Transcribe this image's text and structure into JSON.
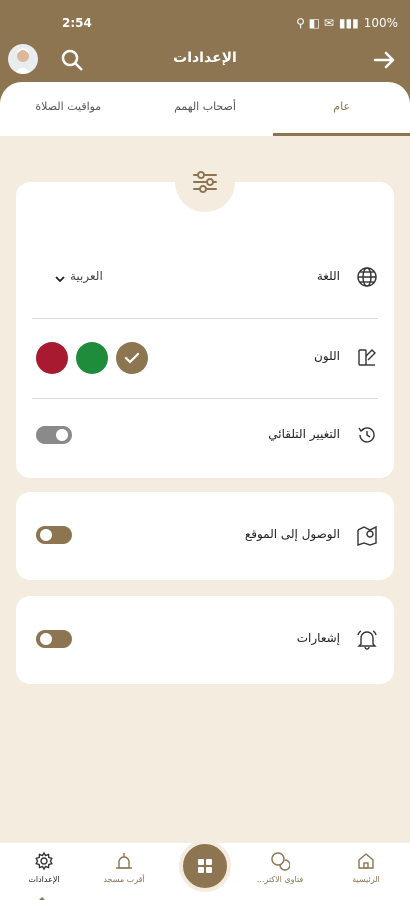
{
  "status": {
    "time": "2:54",
    "battery": "100%"
  },
  "header": {
    "title": "الإعدادات"
  },
  "tabs": [
    {
      "label": "عام",
      "active": true
    },
    {
      "label": "أصحاب الهمم",
      "active": false
    },
    {
      "label": "مواقيت الصلاة",
      "active": false
    }
  ],
  "settings": {
    "language": {
      "label": "اللغة",
      "value": "العربية"
    },
    "color": {
      "label": "اللون",
      "options": [
        "#8c7550",
        "#1e8c3a",
        "#a81a30"
      ],
      "selected": "#8c7550"
    },
    "auto_change": {
      "label": "التغيير التلقائي",
      "enabled": false
    },
    "location": {
      "label": "الوصول إلى الموقع",
      "enabled": false
    },
    "notifications": {
      "label": "إشعارات",
      "enabled": false
    }
  },
  "bottom_nav": {
    "home": "الرئيسية",
    "fatwas": "فتاوى الاكتر...",
    "nearest_mosque": "أقرب مسجد",
    "settings": "الإعدادات"
  },
  "colors": {
    "primary": "#8c7550",
    "background": "#f5ece0"
  }
}
